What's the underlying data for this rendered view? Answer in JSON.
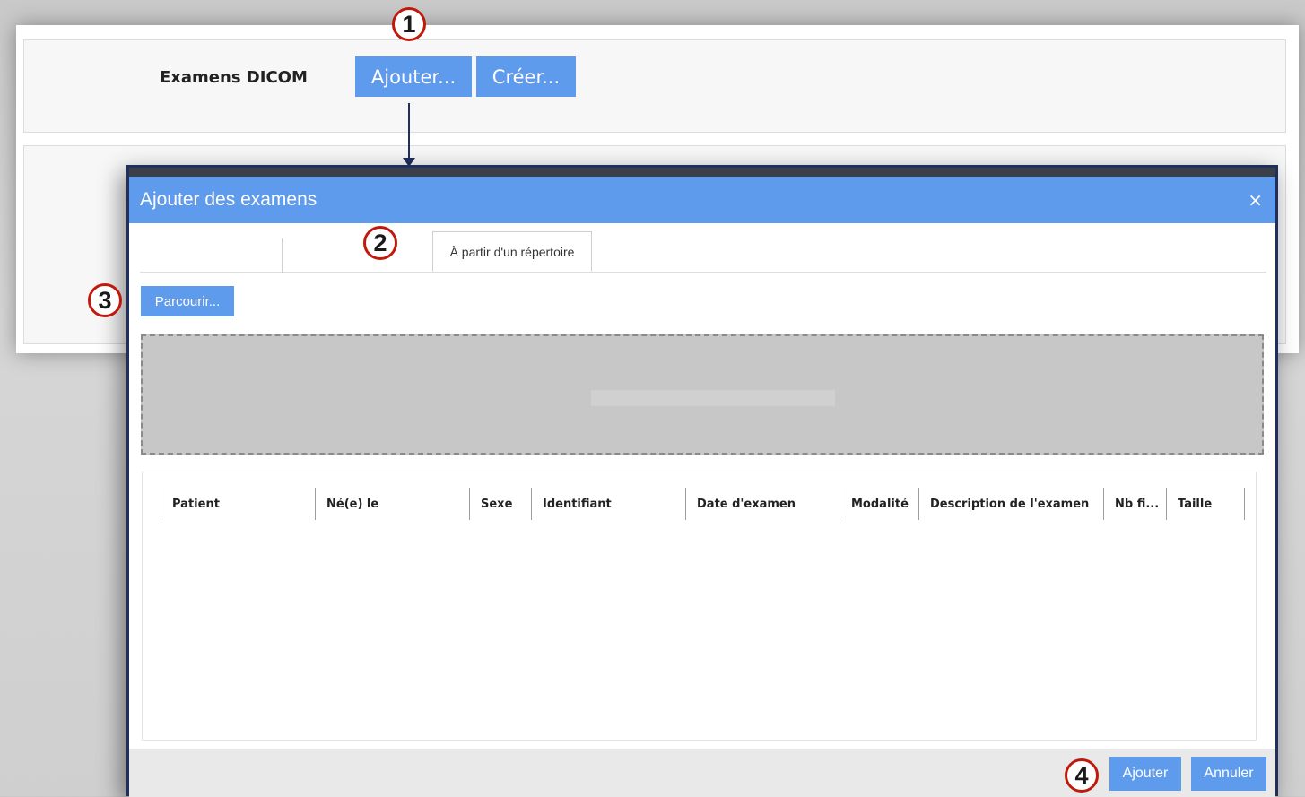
{
  "page": {
    "section_label": "Examens DICOM",
    "add_button": "Ajouter...",
    "create_button": "Créer..."
  },
  "callouts": [
    "1",
    "2",
    "3",
    "4"
  ],
  "dialog": {
    "title": "Ajouter des examens",
    "close_icon": "×",
    "tab_directory": "À partir d'un répertoire",
    "browse_button": "Parcourir...",
    "columns": [
      "Patient",
      "Né(e) le",
      "Sexe",
      "Identifiant",
      "Date d'examen",
      "Modalité",
      "Description de l'examen",
      "Nb fi...",
      "Taille"
    ],
    "add_button": "Ajouter",
    "cancel_button": "Annuler"
  },
  "colors": {
    "accent": "#5f9bec",
    "callout_border": "#c0190c",
    "dialog_border": "#1f2f5e"
  }
}
